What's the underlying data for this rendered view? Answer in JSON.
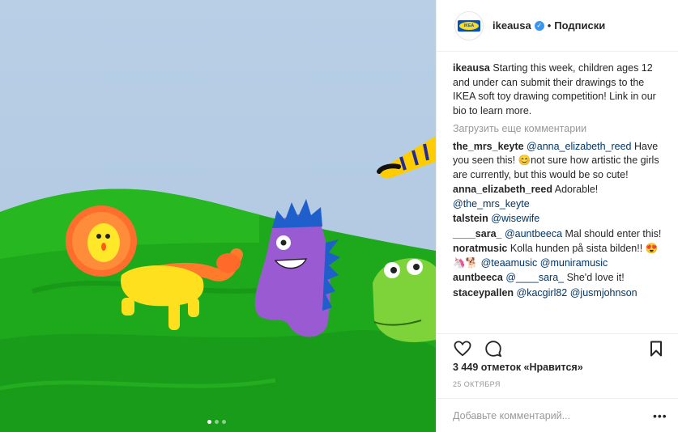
{
  "photo": {
    "alt_icon": "photo-carousel",
    "carousel_dots": 3,
    "active_dot": 0
  },
  "header": {
    "avatar_logo_text": "IKEA",
    "username": "ikeausa",
    "verified_icon": "verified-badge-icon",
    "separator": "•",
    "follow_label": "Подписки"
  },
  "caption": {
    "username": "ikeausa",
    "text": "Starting this week, children ages 12 and under can submit their drawings to the IKEA soft toy drawing competition! Link in our bio to learn more."
  },
  "load_more": "Загрузить еще комментарии",
  "comments": [
    {
      "user": "the_mrs_keyte",
      "parts": [
        {
          "t": "mention",
          "v": "@anna_elizabeth_reed"
        },
        {
          "t": "text",
          "v": " Have you seen this! 😊not sure how artistic the girls are currently, but this would be so cute!"
        }
      ]
    },
    {
      "user": "anna_elizabeth_reed",
      "parts": [
        {
          "t": "text",
          "v": "Adorable! "
        },
        {
          "t": "mention",
          "v": "@the_mrs_keyte"
        }
      ]
    },
    {
      "user": "talstein",
      "parts": [
        {
          "t": "mention",
          "v": "@wisewife"
        }
      ]
    },
    {
      "user": "____sara_",
      "parts": [
        {
          "t": "mention",
          "v": "@auntbeeca"
        },
        {
          "t": "text",
          "v": " Mal should enter this!"
        }
      ]
    },
    {
      "user": "noratmusic",
      "parts": [
        {
          "t": "text",
          "v": "Kolla hunden på sista bilden!! 😍🦄🐕 "
        },
        {
          "t": "mention",
          "v": "@teaamusic"
        },
        {
          "t": "text",
          "v": " "
        },
        {
          "t": "mention",
          "v": "@muniramusic"
        }
      ]
    },
    {
      "user": "auntbeeca",
      "parts": [
        {
          "t": "mention",
          "v": "@____sara_"
        },
        {
          "t": "text",
          "v": " She'd love it!"
        }
      ]
    },
    {
      "user": "staceypallen",
      "parts": [
        {
          "t": "mention",
          "v": "@kacgirl82"
        },
        {
          "t": "text",
          "v": " "
        },
        {
          "t": "mention",
          "v": "@jusmjohnson"
        }
      ]
    }
  ],
  "actions": {
    "like_icon": "heart-icon",
    "comment_icon": "comment-bubble-icon",
    "save_icon": "bookmark-icon",
    "likes_text": "3 449 отметок «Нравится»",
    "date": "25 ОКТЯБРЯ"
  },
  "add_comment": {
    "placeholder": "Добавьте комментарий...",
    "more_label": "•••"
  },
  "colors": {
    "mention": "#003569",
    "verified": "#3897f0",
    "muted": "#999999",
    "ikea_blue": "#0051ba",
    "ikea_yellow": "#ffda1a"
  }
}
